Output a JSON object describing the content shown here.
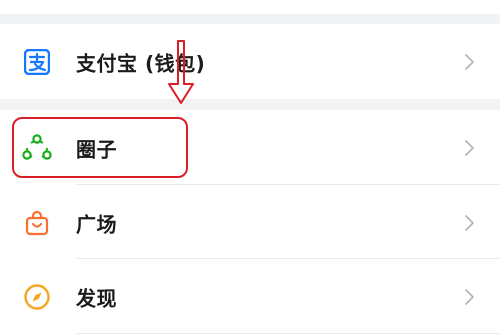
{
  "menu": {
    "items": [
      {
        "id": "alipay-wallet",
        "label": "支付宝 (钱包)",
        "icon": "alipay-icon",
        "color": "#1677ff"
      },
      {
        "id": "circle",
        "label": "圈子",
        "icon": "circle-group-icon",
        "color": "#1aad19"
      },
      {
        "id": "plaza",
        "label": "广场",
        "icon": "shopping-bag-icon",
        "color": "#fa6e32"
      },
      {
        "id": "discover",
        "label": "发现",
        "icon": "compass-icon",
        "color": "#f5a623"
      }
    ]
  },
  "annotation": {
    "highlight_color": "#d81f26",
    "target": "circle"
  }
}
